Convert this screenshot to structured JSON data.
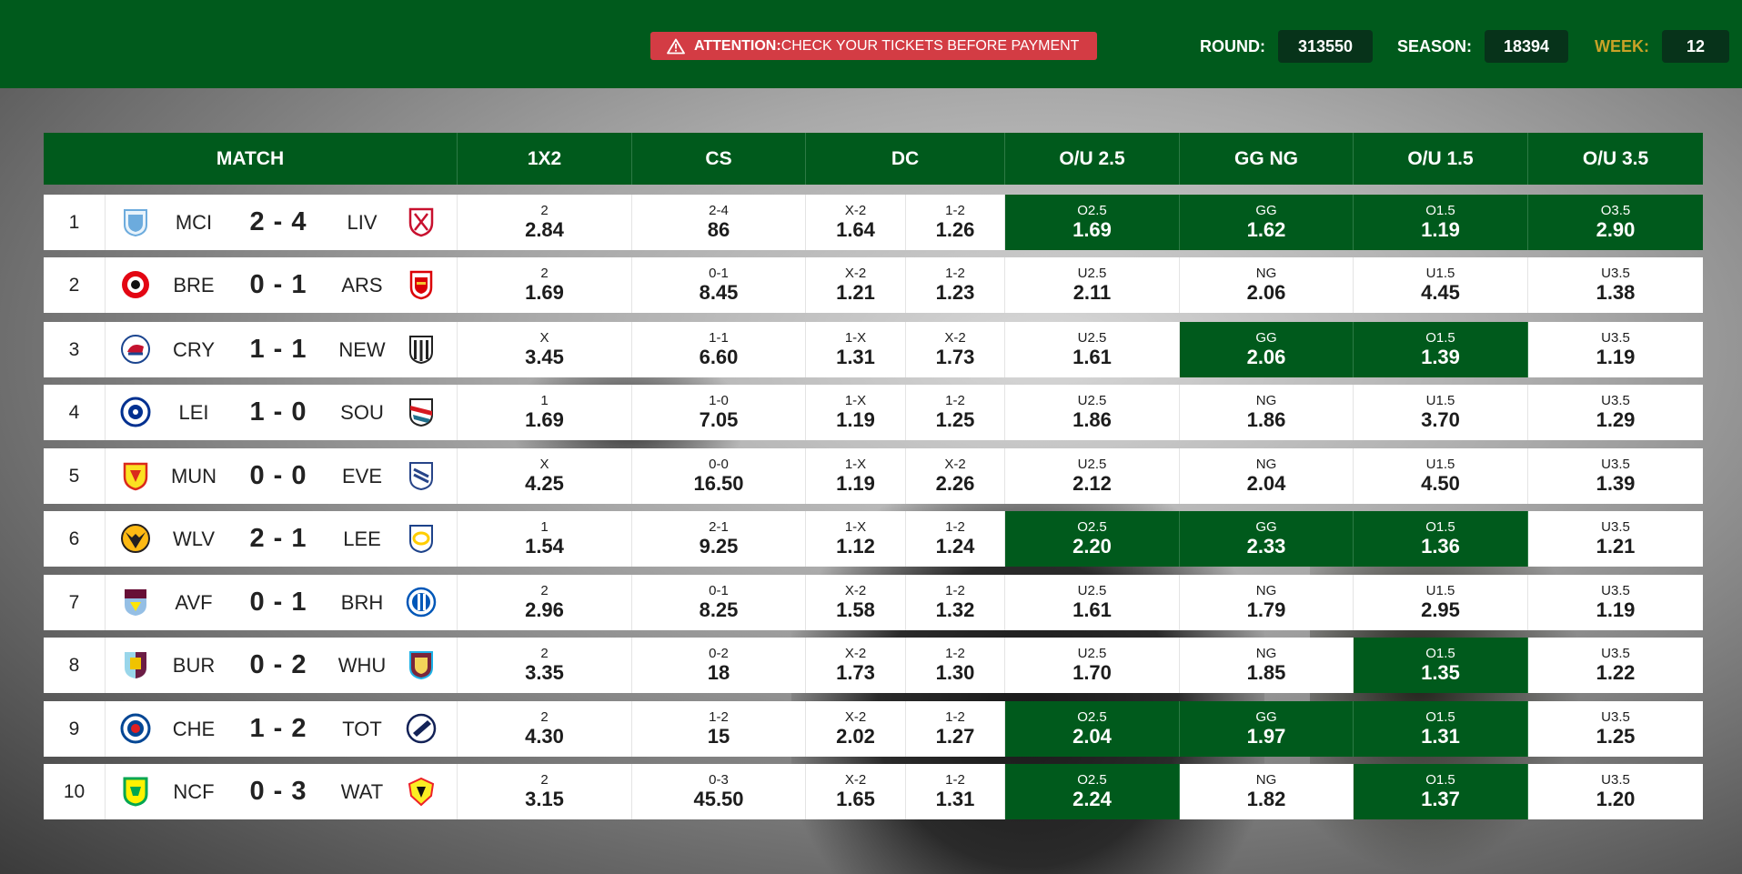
{
  "header": {
    "alert_strong": "ATTENTION:",
    "alert_text": "CHECK YOUR TICKETS BEFORE PAYMENT",
    "round_label": "ROUND:",
    "round_value": "313550",
    "season_label": "SEASON:",
    "season_value": "18394",
    "week_label": "WEEK:",
    "week_value": "12",
    "colors": {
      "green": "#005a1c",
      "alert": "#d33c44",
      "week_label": "#c9a227"
    }
  },
  "columns": [
    "MATCH",
    "1X2",
    "CS",
    "DC",
    "O/U 2.5",
    "GG NG",
    "O/U 1.5",
    "O/U 3.5"
  ],
  "matches": [
    {
      "n": "1",
      "home": "MCI",
      "away": "LIV",
      "score": "2 - 4",
      "home_icon": "man-city-crest-icon",
      "away_icon": "liverpool-crest-icon",
      "x12": [
        "2",
        "2.84"
      ],
      "cs": [
        "2-4",
        "86"
      ],
      "dc1": [
        "X-2",
        "1.64"
      ],
      "dc2": [
        "1-2",
        "1.26"
      ],
      "ou25": [
        "O2.5",
        "1.69"
      ],
      "gg": [
        "GG",
        "1.62"
      ],
      "ou15": [
        "O1.5",
        "1.19"
      ],
      "ou35": [
        "O3.5",
        "2.90"
      ]
    },
    {
      "n": "2",
      "home": "BRE",
      "away": "ARS",
      "score": "0 - 1",
      "home_icon": "brentford-crest-icon",
      "away_icon": "arsenal-crest-icon",
      "x12": [
        "2",
        "1.69"
      ],
      "cs": [
        "0-1",
        "8.45"
      ],
      "dc1": [
        "X-2",
        "1.21"
      ],
      "dc2": [
        "1-2",
        "1.23"
      ],
      "ou25": [
        "U2.5",
        "2.11"
      ],
      "gg": [
        "NG",
        "2.06"
      ],
      "ou15": [
        "U1.5",
        "4.45"
      ],
      "ou35": [
        "U3.5",
        "1.38"
      ]
    },
    {
      "n": "3",
      "home": "CRY",
      "away": "NEW",
      "score": "1 - 1",
      "home_icon": "crystal-palace-crest-icon",
      "away_icon": "newcastle-crest-icon",
      "x12": [
        "X",
        "3.45"
      ],
      "cs": [
        "1-1",
        "6.60"
      ],
      "dc1": [
        "1-X",
        "1.31"
      ],
      "dc2": [
        "X-2",
        "1.73"
      ],
      "ou25": [
        "U2.5",
        "1.61"
      ],
      "gg": [
        "GG",
        "2.06"
      ],
      "ou15": [
        "O1.5",
        "1.39"
      ],
      "ou35": [
        "U3.5",
        "1.19"
      ]
    },
    {
      "n": "4",
      "home": "LEI",
      "away": "SOU",
      "score": "1 - 0",
      "home_icon": "leicester-crest-icon",
      "away_icon": "southampton-crest-icon",
      "x12": [
        "1",
        "1.69"
      ],
      "cs": [
        "1-0",
        "7.05"
      ],
      "dc1": [
        "1-X",
        "1.19"
      ],
      "dc2": [
        "1-2",
        "1.25"
      ],
      "ou25": [
        "U2.5",
        "1.86"
      ],
      "gg": [
        "NG",
        "1.86"
      ],
      "ou15": [
        "U1.5",
        "3.70"
      ],
      "ou35": [
        "U3.5",
        "1.29"
      ]
    },
    {
      "n": "5",
      "home": "MUN",
      "away": "EVE",
      "score": "0 - 0",
      "home_icon": "man-united-crest-icon",
      "away_icon": "everton-crest-icon",
      "x12": [
        "X",
        "4.25"
      ],
      "cs": [
        "0-0",
        "16.50"
      ],
      "dc1": [
        "1-X",
        "1.19"
      ],
      "dc2": [
        "X-2",
        "2.26"
      ],
      "ou25": [
        "U2.5",
        "2.12"
      ],
      "gg": [
        "NG",
        "2.04"
      ],
      "ou15": [
        "U1.5",
        "4.50"
      ],
      "ou35": [
        "U3.5",
        "1.39"
      ]
    },
    {
      "n": "6",
      "home": "WLV",
      "away": "LEE",
      "score": "2 - 1",
      "home_icon": "wolves-crest-icon",
      "away_icon": "leeds-crest-icon",
      "x12": [
        "1",
        "1.54"
      ],
      "cs": [
        "2-1",
        "9.25"
      ],
      "dc1": [
        "1-X",
        "1.12"
      ],
      "dc2": [
        "1-2",
        "1.24"
      ],
      "ou25": [
        "O2.5",
        "2.20"
      ],
      "gg": [
        "GG",
        "2.33"
      ],
      "ou15": [
        "O1.5",
        "1.36"
      ],
      "ou35": [
        "U3.5",
        "1.21"
      ]
    },
    {
      "n": "7",
      "home": "AVF",
      "away": "BRH",
      "score": "0 - 1",
      "home_icon": "aston-villa-crest-icon",
      "away_icon": "brighton-crest-icon",
      "x12": [
        "2",
        "2.96"
      ],
      "cs": [
        "0-1",
        "8.25"
      ],
      "dc1": [
        "X-2",
        "1.58"
      ],
      "dc2": [
        "1-2",
        "1.32"
      ],
      "ou25": [
        "U2.5",
        "1.61"
      ],
      "gg": [
        "NG",
        "1.79"
      ],
      "ou15": [
        "U1.5",
        "2.95"
      ],
      "ou35": [
        "U3.5",
        "1.19"
      ]
    },
    {
      "n": "8",
      "home": "BUR",
      "away": "WHU",
      "score": "0 - 2",
      "home_icon": "burnley-crest-icon",
      "away_icon": "west-ham-crest-icon",
      "x12": [
        "2",
        "3.35"
      ],
      "cs": [
        "0-2",
        "18"
      ],
      "dc1": [
        "X-2",
        "1.73"
      ],
      "dc2": [
        "1-2",
        "1.30"
      ],
      "ou25": [
        "U2.5",
        "1.70"
      ],
      "gg": [
        "NG",
        "1.85"
      ],
      "ou15": [
        "O1.5",
        "1.35"
      ],
      "ou35": [
        "U3.5",
        "1.22"
      ]
    },
    {
      "n": "9",
      "home": "CHE",
      "away": "TOT",
      "score": "1 - 2",
      "home_icon": "chelsea-crest-icon",
      "away_icon": "tottenham-crest-icon",
      "x12": [
        "2",
        "4.30"
      ],
      "cs": [
        "1-2",
        "15"
      ],
      "dc1": [
        "X-2",
        "2.02"
      ],
      "dc2": [
        "1-2",
        "1.27"
      ],
      "ou25": [
        "O2.5",
        "2.04"
      ],
      "gg": [
        "GG",
        "1.97"
      ],
      "ou15": [
        "O1.5",
        "1.31"
      ],
      "ou35": [
        "U3.5",
        "1.25"
      ]
    },
    {
      "n": "10",
      "home": "NCF",
      "away": "WAT",
      "score": "0 - 3",
      "home_icon": "norwich-crest-icon",
      "away_icon": "watford-crest-icon",
      "x12": [
        "2",
        "3.15"
      ],
      "cs": [
        "0-3",
        "45.50"
      ],
      "dc1": [
        "X-2",
        "1.65"
      ],
      "dc2": [
        "1-2",
        "1.31"
      ],
      "ou25": [
        "O2.5",
        "2.24"
      ],
      "gg": [
        "NG",
        "1.82"
      ],
      "ou15": [
        "O1.5",
        "1.37"
      ],
      "ou35": [
        "U3.5",
        "1.20"
      ]
    }
  ]
}
